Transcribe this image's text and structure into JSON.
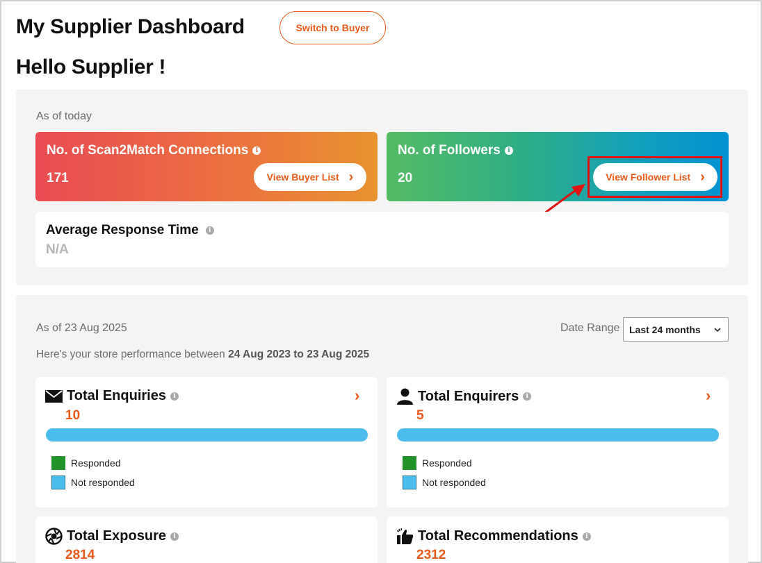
{
  "header": {
    "title": "My Supplier Dashboard",
    "switch_label": "Switch to Buyer",
    "greeting": "Hello Supplier !"
  },
  "today_section": {
    "as_of": "As of today",
    "connections": {
      "title": "No. of Scan2Match Connections",
      "value": "171",
      "button_label": "View Buyer List"
    },
    "followers": {
      "title": "No. of Followers",
      "value": "20",
      "button_label": "View Follower List"
    },
    "avg_response": {
      "title": "Average Response Time",
      "value": "N/A"
    }
  },
  "performance": {
    "as_of": "As of 23 Aug 2025",
    "date_range_label": "Date Range",
    "date_range_value": "Last 24 months",
    "summary_prefix": "Here's your store performance between ",
    "summary_range": "24 Aug 2023 to 23 Aug 2025",
    "legend_responded": "Responded",
    "legend_not_responded": "Not responded",
    "enquiries": {
      "title": "Total Enquiries",
      "value": "10",
      "responded_fraction": 0.0
    },
    "enquirers": {
      "title": "Total Enquirers",
      "value": "5",
      "responded_fraction": 0.0
    },
    "exposure": {
      "title": "Total Exposure",
      "value": "2814"
    },
    "recommendations": {
      "title": "Total Recommendations",
      "value": "2312"
    }
  },
  "colors": {
    "accent": "#e8591a",
    "responded": "#22922a",
    "not_responded": "#4cbcec",
    "annotation_red": "#e01212"
  }
}
